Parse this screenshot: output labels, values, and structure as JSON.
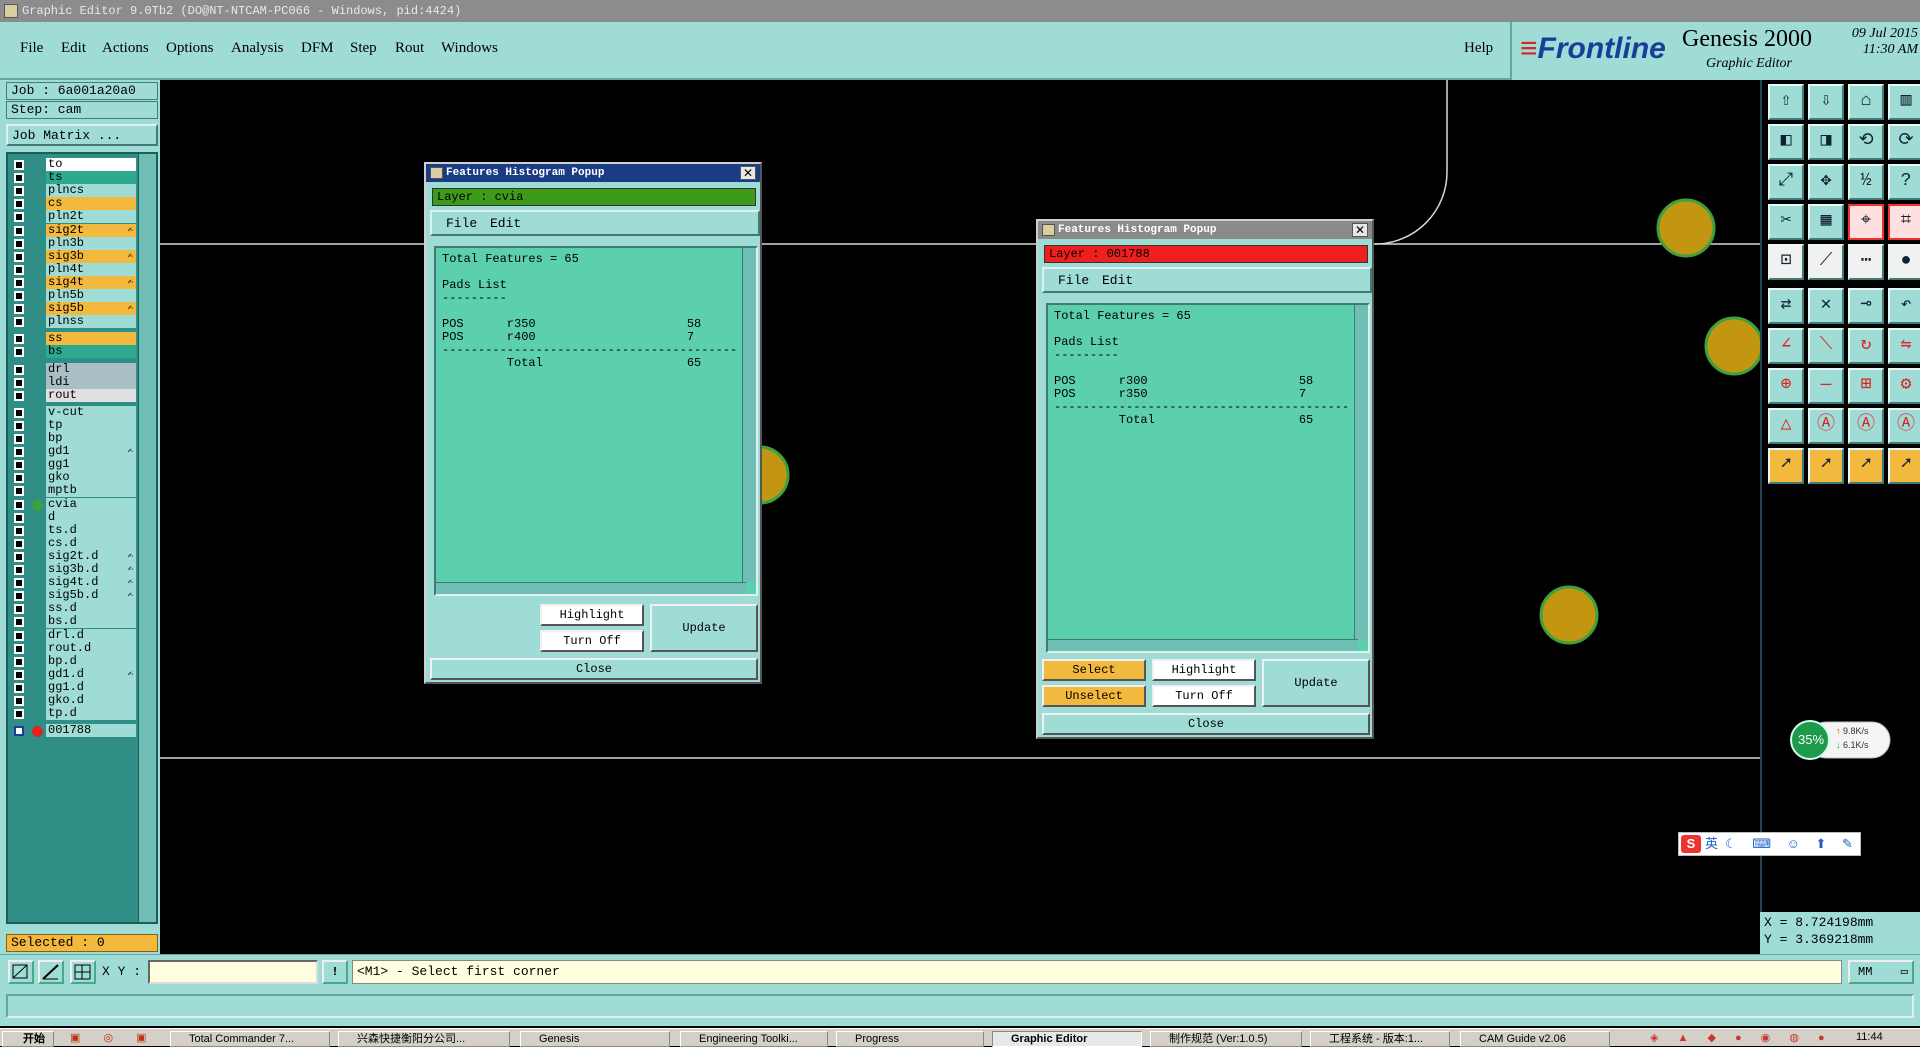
{
  "window": {
    "title": "Graphic Editor 9.0Tb2 (DO@NT-NTCAM-PC066 - Windows, pid:4424)"
  },
  "menu": {
    "items": [
      "File",
      "Edit",
      "Actions",
      "Options",
      "Analysis",
      "DFM",
      "Step",
      "Rout",
      "Windows"
    ],
    "help": "Help"
  },
  "brand": {
    "logo_a": "≡",
    "logo_b": "Frontline",
    "product": "Genesis 2000",
    "subtitle": "Graphic Editor",
    "date": "09 Jul 2015",
    "time": "11:30 AM"
  },
  "left": {
    "job": "Job : 6a001a20a0",
    "step": "Step: cam",
    "matrix_button": "Job Matrix ...",
    "selected": "Selected : 0"
  },
  "layers": [
    {
      "name": "to",
      "color": "#ffffff"
    },
    {
      "name": "ts",
      "color": "#2ea88e"
    },
    {
      "name": "plncs",
      "color": "#9fdcd6"
    },
    {
      "name": "cs",
      "color": "#f3b83e"
    },
    {
      "name": "pln2t",
      "color": "#9fdcd6"
    },
    {
      "name": "sig2t",
      "color": "#f3b83e",
      "flag": "✍"
    },
    {
      "name": "pln3b",
      "color": "#9fdcd6"
    },
    {
      "name": "sig3b",
      "color": "#f3b83e",
      "flag": "✍"
    },
    {
      "name": "pln4t",
      "color": "#9fdcd6"
    },
    {
      "name": "sig4t",
      "color": "#f3b83e",
      "flag": "✍"
    },
    {
      "name": "pln5b",
      "color": "#9fdcd6"
    },
    {
      "name": "sig5b",
      "color": "#f3b83e",
      "flag": "✍"
    },
    {
      "name": "plnss",
      "color": "#9fdcd6"
    },
    {
      "name": "ss",
      "color": "#f3b83e"
    },
    {
      "name": "bs",
      "color": "#2ea88e"
    },
    {
      "name": "drl",
      "color": "#a9bfc4"
    },
    {
      "name": "ldi",
      "color": "#a9bfc4"
    },
    {
      "name": "rout",
      "color": "#e0e0e0"
    },
    {
      "name": "v-cut",
      "color": "#9fdcd6"
    },
    {
      "name": "tp",
      "color": "#9fdcd6"
    },
    {
      "name": "bp",
      "color": "#9fdcd6"
    },
    {
      "name": "gd1",
      "color": "#9fdcd6",
      "flag": "✍"
    },
    {
      "name": "gg1",
      "color": "#9fdcd6"
    },
    {
      "name": "gko",
      "color": "#9fdcd6"
    },
    {
      "name": "mptb",
      "color": "#9fdcd6"
    },
    {
      "name": "cvia",
      "color": "#9fdcd6",
      "dot": "#3fa03f"
    },
    {
      "name": "d",
      "color": "#9fdcd6"
    },
    {
      "name": "ts.d",
      "color": "#9fdcd6"
    },
    {
      "name": "cs.d",
      "color": "#9fdcd6"
    },
    {
      "name": "sig2t.d",
      "color": "#9fdcd6",
      "flag": "✍"
    },
    {
      "name": "sig3b.d",
      "color": "#9fdcd6",
      "flag": "✍"
    },
    {
      "name": "sig4t.d",
      "color": "#9fdcd6",
      "flag": "✍"
    },
    {
      "name": "sig5b.d",
      "color": "#9fdcd6",
      "flag": "✍"
    },
    {
      "name": "ss.d",
      "color": "#9fdcd6"
    },
    {
      "name": "bs.d",
      "color": "#9fdcd6"
    },
    {
      "name": "drl.d",
      "color": "#9fdcd6"
    },
    {
      "name": "rout.d",
      "color": "#9fdcd6"
    },
    {
      "name": "bp.d",
      "color": "#9fdcd6"
    },
    {
      "name": "gd1.d",
      "color": "#9fdcd6",
      "flag": "✍"
    },
    {
      "name": "gg1.d",
      "color": "#9fdcd6"
    },
    {
      "name": "gko.d",
      "color": "#9fdcd6"
    },
    {
      "name": "tp.d",
      "color": "#9fdcd6"
    },
    {
      "name": "001788",
      "color": "#9fdcd6",
      "dot": "#e32222",
      "work": true
    }
  ],
  "popup1": {
    "title": "Features Histogram Popup",
    "layer": "Layer :  cvia",
    "layer_color": "#3e9a1a",
    "menu": [
      "File",
      "Edit"
    ],
    "lines": [
      "Total Features = 65",
      "",
      "Pads List",
      "---------",
      "",
      "POS      r350                     58",
      "POS      r400                     7",
      "-----------------------------------------",
      "         Total                    65"
    ],
    "buttons": {
      "highlight": "Highlight",
      "turnoff": "Turn Off",
      "update": "Update",
      "close": "Close"
    }
  },
  "popup2": {
    "title": "Features Histogram Popup",
    "layer": "Layer :  001788",
    "layer_color": "#ef1f1f",
    "menu": [
      "File",
      "Edit"
    ],
    "lines": [
      "Total Features = 65",
      "",
      "Pads List",
      "---------",
      "",
      "POS      r300                     58",
      "POS      r350                     7",
      "-----------------------------------------",
      "         Total                    65"
    ],
    "buttons": {
      "select": "Select",
      "unselect": "Unselect",
      "highlight": "Highlight",
      "turnoff": "Turn Off",
      "update": "Update",
      "close": "Close"
    }
  },
  "coords": {
    "x": "X = 8.724198mm",
    "y": "Y = 3.369218mm"
  },
  "cmd": {
    "xy_label": "X Y :",
    "xy_value": "",
    "excl": "!",
    "prompt": "<M1> - Select first corner",
    "units": "MM"
  },
  "netmon": {
    "percent": "35%",
    "up": "9.8K/s",
    "down": "6.1K/s"
  },
  "ime": {
    "mode": "英"
  },
  "taskbar": {
    "start": "开始",
    "tasks": [
      "Total Commander 7...",
      "兴森快捷衡阳分公司...",
      "Genesis",
      "Engineering Toolki...",
      "Progress",
      "Graphic Editor",
      "制作规范 (Ver:1.0.5)",
      "工程系统 - 版本:1...",
      "CAM Guide v2.06"
    ],
    "clock": "11:44"
  }
}
